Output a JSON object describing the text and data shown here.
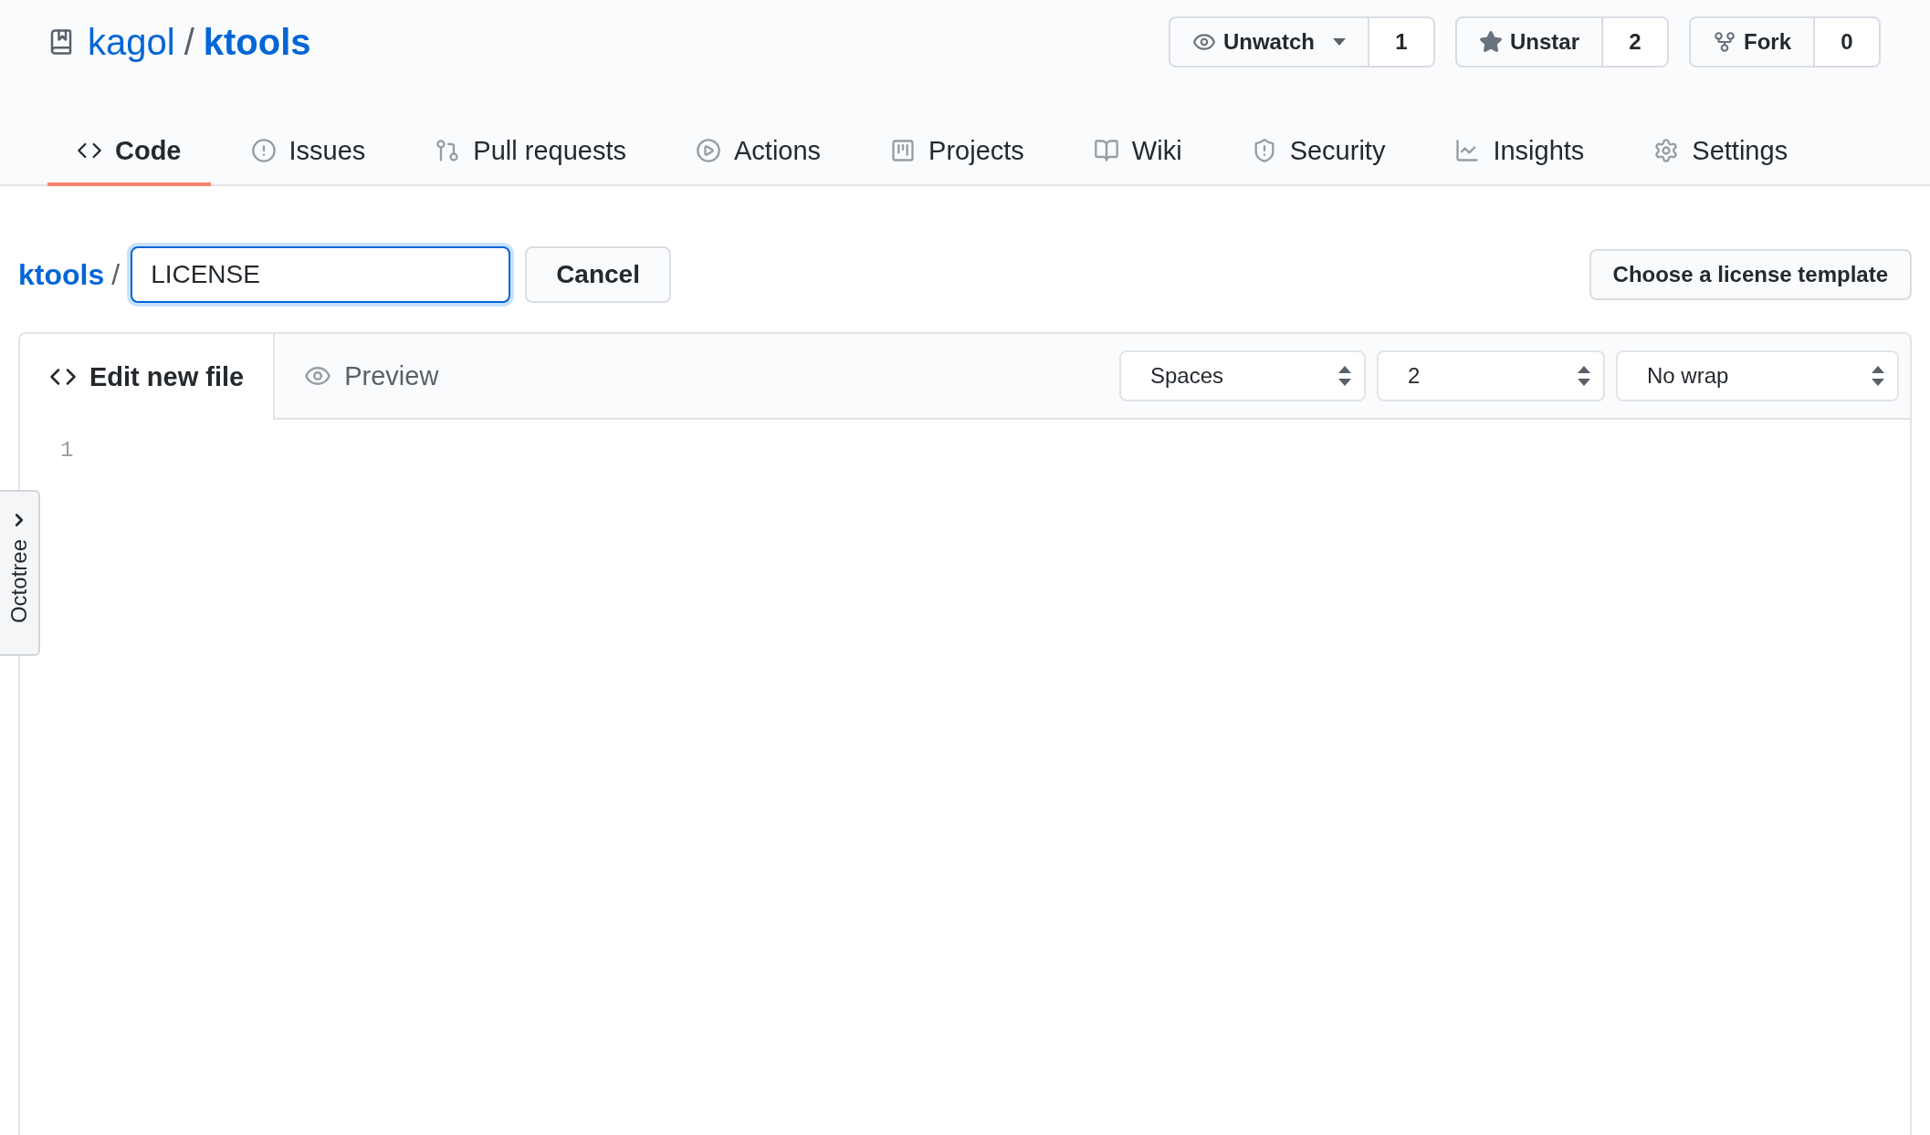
{
  "repo": {
    "owner": "kagol",
    "separator": "/",
    "name": "ktools"
  },
  "repo_actions": [
    {
      "kind": "watch",
      "label": "Unwatch",
      "count": "1"
    },
    {
      "kind": "star",
      "label": "Unstar",
      "count": "2"
    },
    {
      "kind": "fork",
      "label": "Fork",
      "count": "0"
    }
  ],
  "nav_tabs": [
    {
      "kind": "code",
      "label": "Code",
      "selected": true
    },
    {
      "kind": "issues",
      "label": "Issues",
      "selected": false
    },
    {
      "kind": "pulls",
      "label": "Pull requests",
      "selected": false
    },
    {
      "kind": "actions",
      "label": "Actions",
      "selected": false
    },
    {
      "kind": "projects",
      "label": "Projects",
      "selected": false
    },
    {
      "kind": "wiki",
      "label": "Wiki",
      "selected": false
    },
    {
      "kind": "security",
      "label": "Security",
      "selected": false
    },
    {
      "kind": "insights",
      "label": "Insights",
      "selected": false
    },
    {
      "kind": "settings",
      "label": "Settings",
      "selected": false
    }
  ],
  "breadcrumb": {
    "repo": "ktools",
    "separator": "/",
    "filename": "LICENSE"
  },
  "cancel_button": "Cancel",
  "license_button": "Choose a license template",
  "editor": {
    "tabs": [
      {
        "kind": "edit",
        "label": "Edit new file",
        "selected": true
      },
      {
        "kind": "preview",
        "label": "Preview",
        "selected": false
      }
    ],
    "selects": [
      "Spaces",
      "2",
      "No wrap"
    ],
    "line_numbers": [
      "1"
    ]
  },
  "octotree": {
    "label": "Octotree"
  }
}
